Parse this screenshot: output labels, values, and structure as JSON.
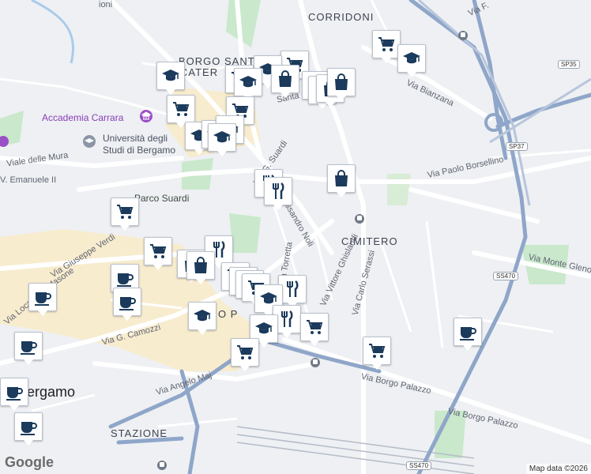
{
  "labels": {
    "corridoni": "CORRIDONI",
    "borgo_santa": "BORGO SANT",
    "cater": "CATER",
    "accademia": "Accademia Carrara",
    "universita_1": "Università degli",
    "universita_2": "Studi di Bergamo",
    "viale_mura": "Viale delle Mura",
    "emanuele": "V. Emanuele II",
    "parco_suardi": "Parco Suardi",
    "via_suardi": "Via G. Suardi",
    "via_fi": "Via F.",
    "via_bianzana": "Via Bianzana",
    "via_borsellino": "Via Paolo Borsellino",
    "via_monte_gleno": "Via Monte Gleno",
    "cimitero": "CIMITERO",
    "via_noli": "Alessandro Noli",
    "via_torretta": "Via Torretta",
    "via_ghislandi": "Via Vittore Ghislandi",
    "via_serassi": "Via Carlo Serassi",
    "via_verdi": "Via Giuseppe Verdi",
    "via_masone": "Via Masone",
    "via_locatelli": "Via Locatelli",
    "via_camozzi": "Via G. Camozzi",
    "via_maj": "Via Angelo Maj",
    "via_borgo_palazzo_1": "Via Borgo Palazzo",
    "via_borgo_palazzo_2": "Via Borgo Palazzo",
    "bergamo": "Bergamo",
    "stazione": "STAZIONE",
    "ioni": "ioni",
    "via_santa": "Santa",
    "pf": "O P",
    "sp35": "SP35",
    "sp37": "SP37",
    "ss470_1": "SS470",
    "ss470_2": "SS470"
  },
  "google": "Google",
  "attribution": "Map data ©2026",
  "icons": {
    "cart": "shopping-cart-icon",
    "edu": "graduation-cap-icon",
    "bag": "shopping-bag-icon",
    "food": "fork-knife-icon",
    "cafe": "coffee-cup-icon",
    "museum": "museum-icon",
    "transit": "transit-station-icon"
  },
  "markers": [
    {
      "type": "cart"
    },
    {
      "type": "edu"
    },
    {
      "type": "cart"
    },
    {
      "type": "edu"
    },
    {
      "type": "cart"
    },
    {
      "type": "edu"
    },
    {
      "type": "bag"
    },
    {
      "type": "bag"
    },
    {
      "type": "bag"
    },
    {
      "type": "bag"
    },
    {
      "type": "bag"
    },
    {
      "type": "edu"
    },
    {
      "type": "cart"
    },
    {
      "type": "cart"
    },
    {
      "type": "edu"
    },
    {
      "type": "edu"
    },
    {
      "type": "edu"
    },
    {
      "type": "edu"
    },
    {
      "type": "bag"
    },
    {
      "type": "food"
    },
    {
      "type": "food"
    },
    {
      "type": "cart"
    },
    {
      "type": "cart"
    },
    {
      "type": "food"
    },
    {
      "type": "bag"
    },
    {
      "type": "bag"
    },
    {
      "type": "cart"
    },
    {
      "type": "cart"
    },
    {
      "type": "cart"
    },
    {
      "type": "cart"
    },
    {
      "type": "food"
    },
    {
      "type": "edu"
    },
    {
      "type": "food"
    },
    {
      "type": "edu"
    },
    {
      "type": "edu"
    },
    {
      "type": "cart"
    },
    {
      "type": "cart"
    },
    {
      "type": "cafe"
    },
    {
      "type": "cafe"
    },
    {
      "type": "cafe"
    },
    {
      "type": "cart"
    },
    {
      "type": "cafe"
    },
    {
      "type": "cafe"
    },
    {
      "type": "cafe"
    },
    {
      "type": "cafe"
    }
  ],
  "colors": {
    "background": "#eef0f3",
    "road": "#ffffff",
    "highway": "#8fa6c9",
    "park": "#bfe3c4",
    "old_town": "#f8eccf",
    "marker_icon": "#1b3a5c"
  }
}
